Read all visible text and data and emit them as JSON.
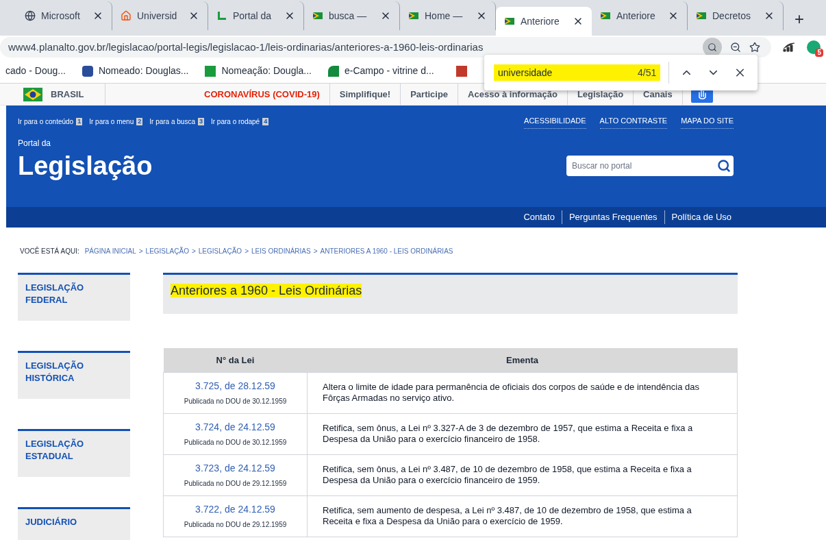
{
  "browser": {
    "tabs": [
      {
        "title": "Microsoft",
        "selected": false
      },
      {
        "title": "Universid",
        "selected": false
      },
      {
        "title": "Portal da",
        "selected": false
      },
      {
        "title": "busca —",
        "selected": false
      },
      {
        "title": "Home —",
        "selected": false
      },
      {
        "title": "Anteriore",
        "selected": true
      },
      {
        "title": "Anteriore",
        "selected": false
      },
      {
        "title": "Decretos",
        "selected": false
      }
    ],
    "new_tab": "+",
    "url": "www4.planalto.gov.br/legislacao/portal-legis/legislacao-1/leis-ordinarias/anteriores-a-1960-leis-ordinarias",
    "extension_badge": "5",
    "bookmarks": [
      "cado - Doug...",
      "Nomeado: Douglas...",
      "Nomeação: Dougla...",
      "e-Campo - vitrine d..."
    ],
    "find_bar": {
      "query": "universidade",
      "count": "4/51"
    }
  },
  "gov_bar": {
    "brand": "BRASIL",
    "items": [
      {
        "label": "CORONAVÍRUS (COVID-19)",
        "alert": true
      },
      {
        "label": "Simplifique!",
        "alert": false
      },
      {
        "label": "Participe",
        "alert": false
      },
      {
        "label": "Acesso à informação",
        "alert": false
      },
      {
        "label": "Legislação",
        "alert": false
      },
      {
        "label": "Canais",
        "alert": false
      }
    ]
  },
  "header": {
    "skip_links": [
      {
        "label": "Ir para o conteúdo",
        "key": "1"
      },
      {
        "label": "Ir para o menu",
        "key": "2"
      },
      {
        "label": "Ir para a busca",
        "key": "3"
      },
      {
        "label": "Ir para o rodapé",
        "key": "4"
      }
    ],
    "top_links": [
      "ACESSIBILIDADE",
      "ALTO CONTRASTE",
      "MAPA DO SITE"
    ],
    "subtitle": "Portal da",
    "title": "Legislação",
    "search": {
      "placeholder": "Buscar no portal"
    },
    "bottom_links": [
      "Contato",
      "Perguntas Frequentes",
      "Política de Uso"
    ]
  },
  "breadcrumb": {
    "label": "VOCÊ ESTÁ AQUI:",
    "separators": [
      ">",
      ">",
      ">",
      ">"
    ],
    "items": [
      "PÁGINA INICIAL",
      "LEGISLAÇÃO",
      "LEGISLAÇÃO",
      "LEIS ORDINÁRIAS",
      "ANTERIORES A 1960 - LEIS ORDINÁRIAS"
    ]
  },
  "sidebar": [
    "LEGISLAÇÃO FEDERAL",
    "LEGISLAÇÃO HISTÓRICA",
    "LEGISLAÇÃO ESTADUAL",
    "JUDICIÁRIO"
  ],
  "page_title": {
    "text": "Anteriores a 1960 - Leis Ordinárias",
    "highlighted": true
  },
  "table": {
    "columns": [
      "N° da Lei",
      "Ementa"
    ],
    "rows": [
      {
        "law": "3.725, de 28.12.59",
        "published": "Publicada no DOU de 30.12.1959",
        "summary": "Altera o limite de idade para permanência de oficiais dos corpos de saúde e de intendência das Fôrças Armadas no serviço ativo."
      },
      {
        "law": "3.724, de 24.12.59",
        "published": "Publicada no DOU de 30.12.1959",
        "summary": "Retifica, sem ônus, a Lei nº 3.327-A de 3 de dezembro de 1957, que estima a Receita e fixa a Despesa da União para o exercício financeiro de 1958."
      },
      {
        "law": "3.723, de 24.12.59",
        "published": "Publicada no DOU de 29.12.1959",
        "summary": "Retifica, sem ônus, a Lei nº 3.487, de 10 de dezembro de 1958, que estima a Receita e fixa a Despesa da União para o exercício financeiro de 1959."
      },
      {
        "law": "3.722, de 24.12.59",
        "published": "Publicada no DOU de 29.12.1959",
        "summary": "Retifica, sem aumento de despesa, a Lei nº 3.487, de 10 de dezembro de 1958, que estima a Receita e fixa a Despesa da União para o exercício de 1959."
      }
    ]
  }
}
